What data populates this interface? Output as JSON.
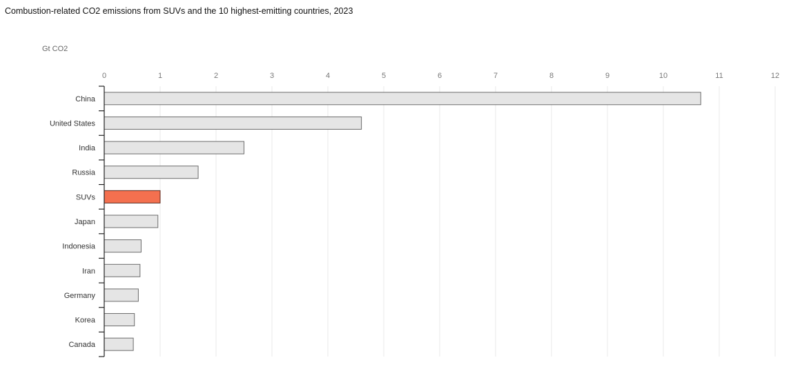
{
  "chart_data": {
    "type": "bar",
    "orientation": "horizontal",
    "title": "Combustion-related CO2 emissions from SUVs and the 10 highest-emitting countries, 2023",
    "unit_label": "Gt CO2",
    "categories": [
      "China",
      "United States",
      "India",
      "Russia",
      "SUVs",
      "Japan",
      "Indonesia",
      "Iran",
      "Germany",
      "Korea",
      "Canada"
    ],
    "values": [
      10.67,
      4.6,
      2.5,
      1.68,
      1.0,
      0.96,
      0.66,
      0.64,
      0.61,
      0.54,
      0.52
    ],
    "highlight": "SUVs",
    "xlim": [
      0,
      12
    ],
    "xticks": [
      0,
      1,
      2,
      3,
      4,
      5,
      6,
      7,
      8,
      9,
      10,
      11,
      12
    ],
    "grid": true,
    "colors": {
      "bar_fill": "#e5e5e5",
      "bar_stroke": "#6b6b6b",
      "highlight_fill": "#f4704f",
      "highlight_stroke": "#5a2a1f",
      "grid": "#e9e9e9",
      "axis": "#222222"
    }
  }
}
